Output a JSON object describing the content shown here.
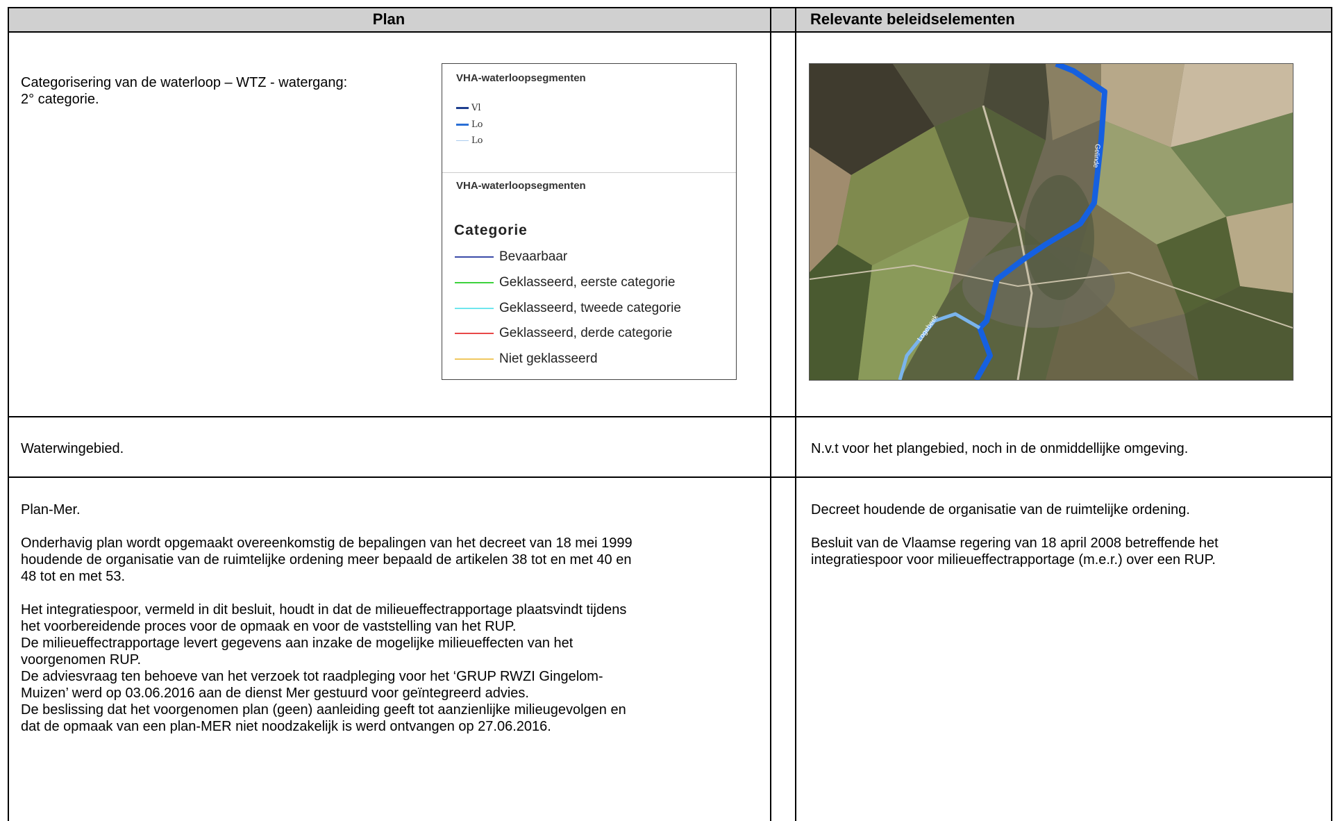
{
  "headers": {
    "plan": "Plan",
    "relevant": "Relevante beleidselementen"
  },
  "row1": {
    "plan_text": "Categorisering van de waterloop – WTZ - watergang:\n2° categorie.",
    "legend": {
      "heading1": "VHA-waterloopsegmenten",
      "small_items": [
        {
          "label": "Vl",
          "color": "#1f3f8f"
        },
        {
          "label": "Lo",
          "color": "#2a6fd6"
        },
        {
          "label": "Lo",
          "color": "#a9cbee"
        }
      ],
      "heading2": "VHA-waterloopsegmenten",
      "category_title": "Categorie",
      "categories": [
        {
          "label": "Bevaarbaar",
          "color": "#3b4ba8"
        },
        {
          "label": "Geklasseerd, eerste categorie",
          "color": "#3cd23c"
        },
        {
          "label": "Geklasseerd, tweede categorie",
          "color": "#6fe6ee"
        },
        {
          "label": "Geklasseerd, derde categorie",
          "color": "#e84848"
        },
        {
          "label": "Niet geklasseerd",
          "color": "#f0c860"
        }
      ]
    },
    "map": {
      "label_main": "Gelinde",
      "label_side": "Logebeek"
    }
  },
  "row2": {
    "plan_text": "Waterwingebied.",
    "relevant_text": "N.v.t voor het plangebied, noch in de onmiddellijke omgeving."
  },
  "row3": {
    "plan_text": "Plan-Mer.\n\nOnderhavig plan wordt opgemaakt overeenkomstig de bepalingen van het decreet van 18 mei 1999\nhoudende de organisatie van de ruimtelijke ordening meer bepaald de artikelen 38 tot en met 40 en\n48 tot en met 53.\n\nHet integratiespoor, vermeld in dit besluit, houdt in dat de milieueffectrapportage plaatsvindt tijdens\nhet voorbereidende proces voor de opmaak en voor de vaststelling van het RUP.\nDe milieueffectrapportage levert gegevens aan inzake de mogelijke milieueffecten van het\nvoorgenomen RUP.\nDe adviesvraag ten behoeve van het verzoek tot raadpleging voor het ‘GRUP RWZI Gingelom-\nMuizen’ werd op 03.06.2016 aan de dienst Mer gestuurd voor geïntegreerd advies.\nDe beslissing dat het voorgenomen plan (geen) aanleiding geeft tot aanzienlijke milieugevolgen en\ndat de opmaak van een plan-MER niet noodzakelijk is werd ontvangen op 27.06.2016.",
    "relevant_text": "Decreet houdende  de organisatie van de ruimtelijke ordening.\n\nBesluit van de Vlaamse regering van 18 april 2008 betreffende het\nintegratiespoor voor milieueffectrapportage (m.e.r.) over een RUP."
  }
}
